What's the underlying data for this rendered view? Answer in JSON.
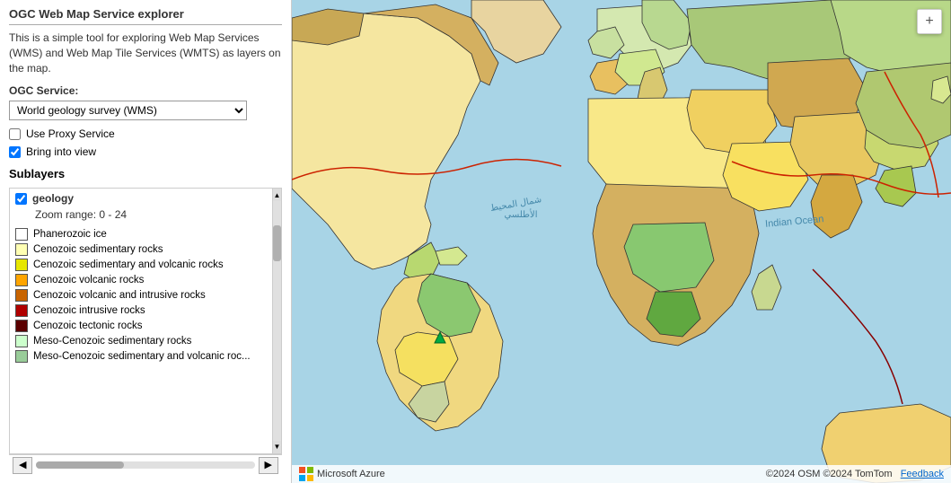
{
  "sidebar": {
    "panel_title": "OGC Web Map Service explorer",
    "description": "This is a simple tool for exploring Web Map Services (WMS) and Web Map Tile Services (WMTS) as layers on the map.",
    "ogc_service_label": "OGC Service:",
    "ogc_service_selected": "World geology survey (WMS)",
    "ogc_service_options": [
      "World geology survey (WMS)"
    ],
    "use_proxy_label": "Use Proxy Service",
    "use_proxy_checked": false,
    "bring_into_view_label": "Bring into view",
    "bring_into_view_checked": true,
    "sublayers_title": "Sublayers",
    "sublayers": [
      {
        "id": "geology",
        "label": "geology",
        "checked": true,
        "zoom_range": "Zoom range: 0 - 24"
      }
    ],
    "legend": [
      {
        "label": "Phanerozoic ice",
        "color": "#ffffff"
      },
      {
        "label": "Cenozoic sedimentary rocks",
        "color": "#ffffb3"
      },
      {
        "label": "Cenozoic sedimentary and volcanic rocks",
        "color": "#e6e600"
      },
      {
        "label": "Cenozoic volcanic rocks",
        "color": "#ffa500"
      },
      {
        "label": "Cenozoic volcanic and intrusive rocks",
        "color": "#c86400"
      },
      {
        "label": "Cenozoic intrusive rocks",
        "color": "#b00000"
      },
      {
        "label": "Cenozoic tectonic rocks",
        "color": "#5a0000"
      },
      {
        "label": "Meso-Cenozoic sedimentary rocks",
        "color": "#ccffcc"
      },
      {
        "label": "Meso-Cenozoic sedimentary and volcanic roc...",
        "color": "#99cc99"
      }
    ]
  },
  "map": {
    "attribution": "©2024 OSM ©2024 TomTom",
    "feedback_label": "Feedback",
    "footer_brand": "Microsoft Azure",
    "ocean_labels": {
      "atlantic": "شمال المحيط الأطلسي",
      "indian": "Indian Ocean"
    }
  },
  "zoom_control": {
    "plus_label": "+",
    "minus_label": "−"
  }
}
